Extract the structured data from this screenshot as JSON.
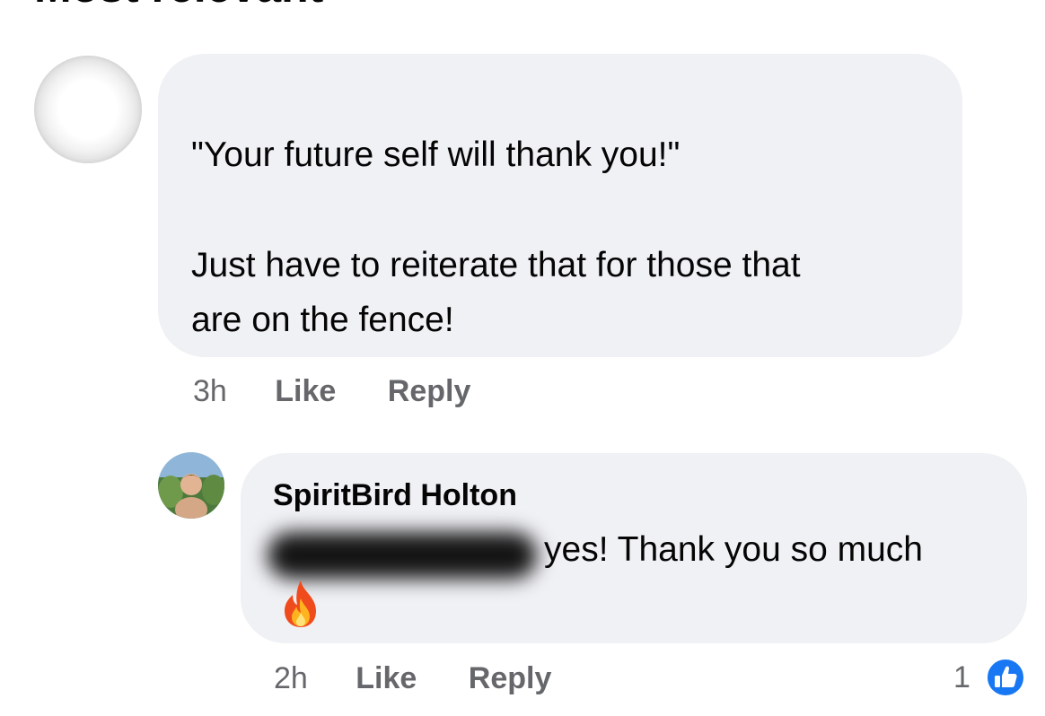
{
  "sort": {
    "label": "Most relevant"
  },
  "comment": {
    "line1": "\"Your future self will thank you!\"",
    "line2": "Just have to reiterate that for those that",
    "line3": "are on the fence!",
    "time": "3h",
    "like_label": "Like",
    "reply_label": "Reply"
  },
  "reply": {
    "author": "SpiritBird Holton",
    "text": "yes! Thank you so much",
    "emoji_icon": "fire-icon",
    "time": "2h",
    "like_label": "Like",
    "reply_label": "Reply",
    "reaction_count": "1",
    "reaction_icon": "thumbs-up-icon",
    "reaction_color": "#1877f2"
  }
}
